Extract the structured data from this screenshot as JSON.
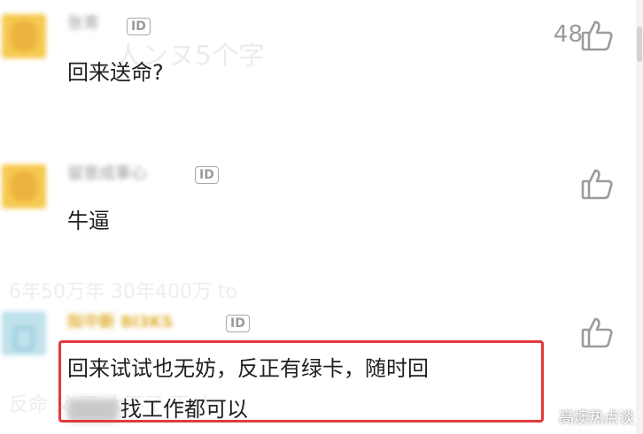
{
  "comments": [
    {
      "username": "张青",
      "id_badge": "ID",
      "text": "回来送命?",
      "likes": "48",
      "avatar_color": "#f6c94f"
    },
    {
      "username": "留意成事心",
      "id_badge": "ID",
      "text": "牛逼",
      "likes": "",
      "avatar_color": "#f6c94f"
    },
    {
      "username": "拟中新 Bl3KS",
      "id_badge": "ID",
      "text_line1": "回来试试也无妨，反正有绿卡，随时回",
      "text_line2": "找工作都可以",
      "likes": "",
      "avatar_color": "#bfe2ec"
    }
  ],
  "watermark": "高燠热点谈",
  "colors": {
    "highlight": "#e23a3a",
    "muted": "#9b9b9b",
    "gold_name": "#e2b33c"
  }
}
